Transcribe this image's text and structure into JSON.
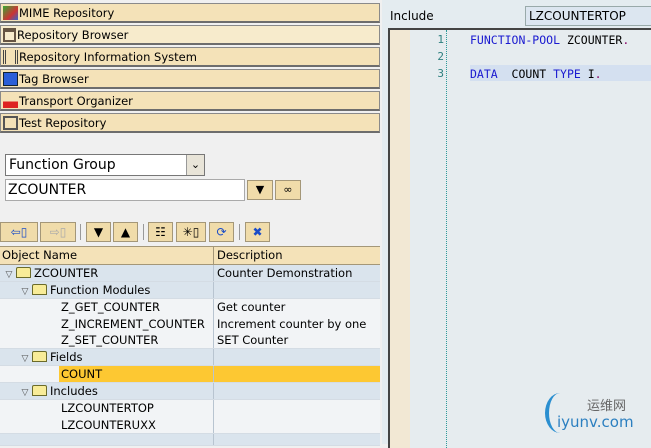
{
  "nav": [
    "MIME Repository",
    "Repository Browser",
    "Repository Information System",
    "Tag Browser",
    "Transport Organizer",
    "Test Repository"
  ],
  "object_type": "Function Group",
  "object_name": "ZCOUNTER",
  "grid": {
    "headers": [
      "Object Name",
      "Description"
    ],
    "rows": [
      {
        "name": "ZCOUNTER",
        "desc": "Counter Demonstration"
      },
      {
        "name": "Function Modules",
        "desc": ""
      },
      {
        "name": "Z_GET_COUNTER",
        "desc": "Get counter"
      },
      {
        "name": "Z_INCREMENT_COUNTER",
        "desc": "Increment counter by one"
      },
      {
        "name": "Z_SET_COUNTER",
        "desc": "SET Counter"
      },
      {
        "name": "Fields",
        "desc": ""
      },
      {
        "name": "COUNT",
        "desc": ""
      },
      {
        "name": "Includes",
        "desc": ""
      },
      {
        "name": "LZCOUNTERTOP",
        "desc": ""
      },
      {
        "name": "LZCOUNTERUXX",
        "desc": ""
      }
    ]
  },
  "editor": {
    "include_label": "Include",
    "include_value": "LZCOUNTERTOP",
    "lines": [
      "1",
      "2",
      "3"
    ],
    "code": {
      "l1_kw": "FUNCTION-POOL",
      "l1_rest": " ZCOUNTER",
      "l1_p": ".",
      "l3_kw1": "DATA",
      "l3_id": "  COUNT ",
      "l3_kw2": "TYPE",
      "l3_rest": " I",
      "l3_p": "."
    }
  },
  "watermark": {
    "cn": "运维网",
    "en": "iyunv.com"
  }
}
